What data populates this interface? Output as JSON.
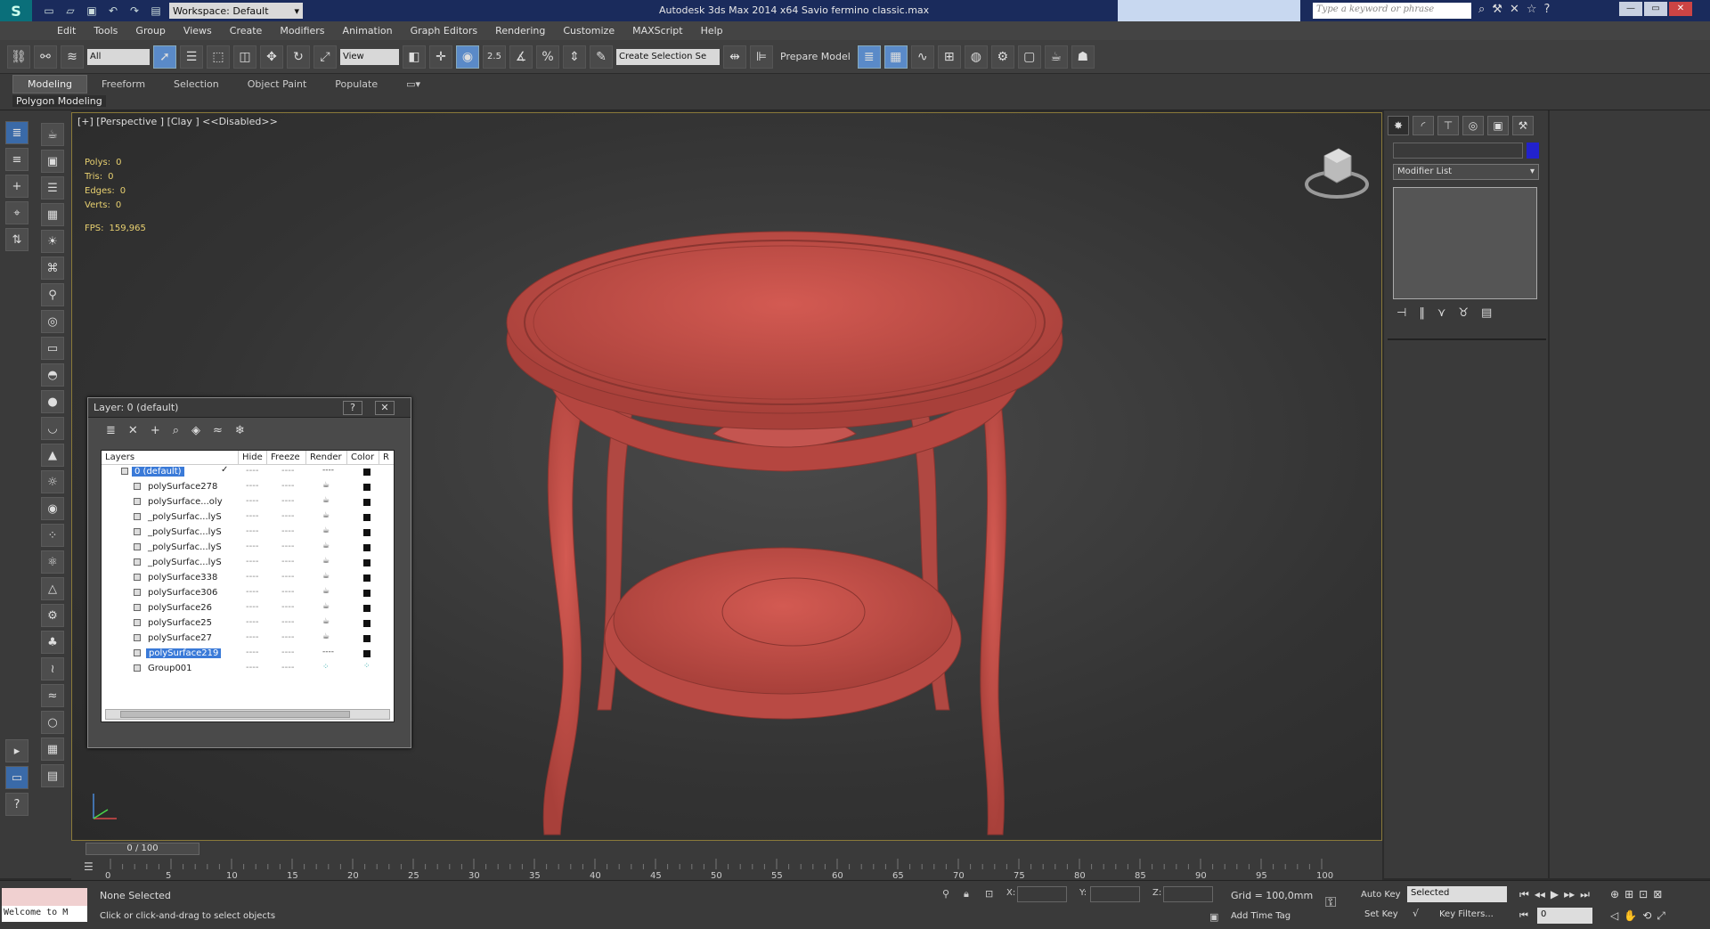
{
  "title": {
    "workspace": "Workspace: Default",
    "window_title": "Autodesk 3ds Max  2014 x64     Savio fermino classic.max",
    "search_placeholder": "Type a keyword or phrase"
  },
  "menu": [
    "Edit",
    "Tools",
    "Group",
    "Views",
    "Create",
    "Modifiers",
    "Animation",
    "Graph Editors",
    "Rendering",
    "Customize",
    "MAXScript",
    "Help"
  ],
  "toolbar": {
    "filter": "All",
    "ref_coord": "View",
    "snap_angle": "2.5",
    "selection_set": "Create Selection Se",
    "prepare_model": "Prepare Model"
  },
  "ribbon": {
    "tabs": [
      "Modeling",
      "Freeform",
      "Selection",
      "Object Paint",
      "Populate"
    ],
    "panel": "Polygon Modeling"
  },
  "viewport": {
    "label": "[+] [Perspective ] [Clay ]  <<Disabled>>",
    "stats": [
      {
        "label": "Polys:",
        "value": "0"
      },
      {
        "label": "Tris:",
        "value": "0"
      },
      {
        "label": "Edges:",
        "value": "0"
      },
      {
        "label": "Verts:",
        "value": "0"
      }
    ],
    "fps_label": "FPS:",
    "fps_value": "159,965",
    "model_color": "#c0504a"
  },
  "layer_window": {
    "title": "Layer: 0 (default)",
    "help": "?",
    "close": "✕",
    "columns": [
      "Layers",
      "Hide",
      "Freeze",
      "Render",
      "Color",
      "R"
    ],
    "top_layer": "0 (default)",
    "rows": [
      "polySurface278",
      "polySurface...oly",
      "_polySurfac...lyS",
      "_polySurfac...lyS",
      "_polySurfac...lyS",
      "_polySurfac...lyS",
      "polySurface338",
      "polySurface306",
      "polySurface26",
      "polySurface25",
      "polySurface27",
      "polySurface219",
      "Group001"
    ],
    "selected_row": "polySurface219"
  },
  "command_panel": {
    "modifier_list": "Modifier List",
    "object_color": "#2222cc"
  },
  "timeline": {
    "slider": "0 / 100",
    "ticks": [
      "0",
      "5",
      "10",
      "15",
      "20",
      "25",
      "30",
      "35",
      "40",
      "45",
      "50",
      "55",
      "60",
      "65",
      "70",
      "75",
      "80",
      "85",
      "90",
      "95",
      "100"
    ]
  },
  "status": {
    "welcome": "Welcome to M",
    "selection": "None Selected",
    "prompt": "Click or click-and-drag to select objects",
    "x_label": "X:",
    "y_label": "Y:",
    "z_label": "Z:",
    "grid": "Grid = 100,0mm",
    "add_time_tag": "Add Time Tag",
    "auto_key": "Auto Key",
    "set_key": "Set Key",
    "selected_dropdown": "Selected",
    "key_filters": "Key Filters...",
    "frame": "0"
  }
}
